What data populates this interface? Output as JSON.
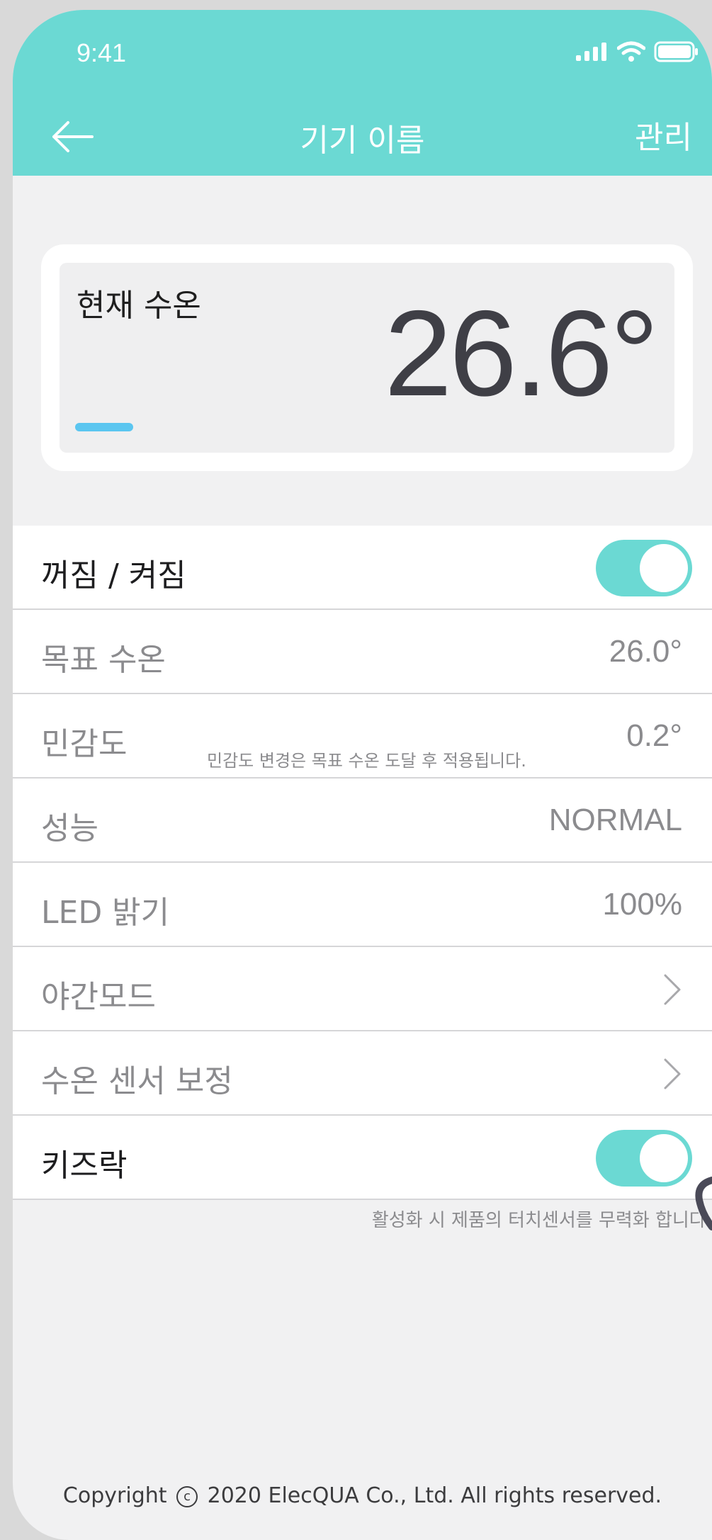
{
  "status_bar": {
    "time": "9:41"
  },
  "nav": {
    "title": "기기 이름",
    "manage_label": "관리"
  },
  "current_temp": {
    "label": "현재 수온",
    "value": "26.6°"
  },
  "settings": {
    "power": {
      "label": "꺼짐 / 켜짐",
      "on": true
    },
    "target_temp": {
      "label": "목표 수온",
      "value": "26.0°"
    },
    "sensitivity": {
      "label": "민감도",
      "note": "민감도 변경은 목표 수온 도달 후 적용됩니다.",
      "value": "0.2°"
    },
    "performance": {
      "label": "성능",
      "value": "NORMAL"
    },
    "led_brightness": {
      "label": "LED 밝기",
      "value": "100%"
    },
    "night_mode": {
      "label": "야간모드"
    },
    "sensor_calibration": {
      "label": "수온 센서 보정"
    },
    "kids_lock": {
      "label": "키즈락",
      "on": true,
      "note": "활성화 시 제품의 터치센서를 무력화 합니다."
    }
  },
  "footer": {
    "prefix": "Copyright",
    "symbol": "c",
    "text": "2020 ElecQUA Co., Ltd. All rights reserved."
  },
  "colors": {
    "accent": "#6bd9d3",
    "temp_indicator": "#5bc6f0"
  }
}
